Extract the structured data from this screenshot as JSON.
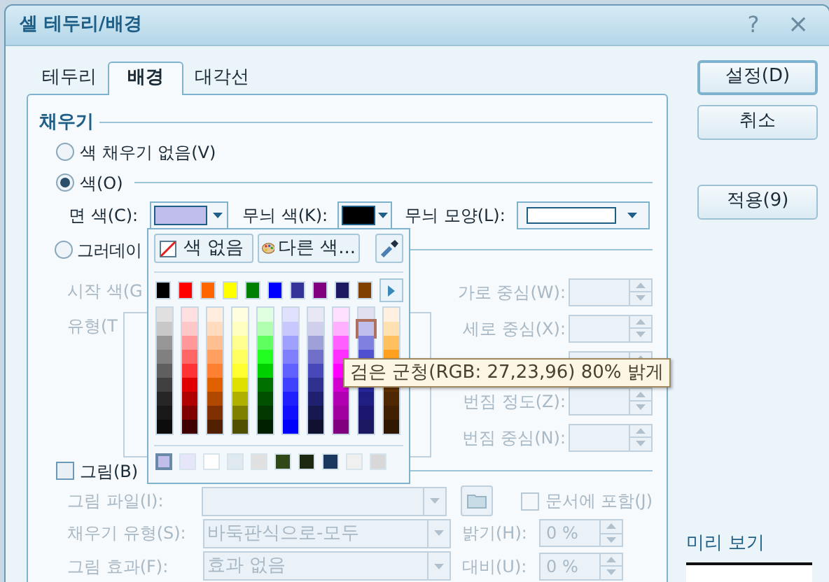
{
  "window": {
    "title": "셀 테두리/배경",
    "help": "?",
    "close": "×"
  },
  "tabs": [
    {
      "label": "테두리",
      "selected": false
    },
    {
      "label": "배경",
      "selected": true
    },
    {
      "label": "대각선",
      "selected": false
    }
  ],
  "fill": {
    "heading": "채우기",
    "options": [
      {
        "label": "색 채우기 없음(V)",
        "selected": false
      },
      {
        "label": "색(O)",
        "selected": true
      },
      {
        "label": "그러데이",
        "selected": false
      }
    ],
    "face_color": {
      "label": "면 색(C):",
      "color": "#c0bfeb"
    },
    "pattern_color": {
      "label": "무늬 색(K):",
      "color": "#000000"
    },
    "pattern_shape": {
      "label": "무늬 모양(L):"
    },
    "gradient_left": [
      "시작 색(G",
      "유형(T"
    ],
    "gradient_right": [
      "가로 중심(W):",
      "세로 중심(X):",
      "번짐 정도(Z):",
      "번짐 중심(N):"
    ]
  },
  "picture": {
    "label": "그림(B)",
    "checked": false,
    "file_label": "그림 파일(I):",
    "embed": {
      "label": "문서에 포함(J)",
      "checked": false
    },
    "fill_type": {
      "label": "채우기 유형(S):",
      "value": "바둑판식으로-모두"
    },
    "brightness": {
      "label": "밝기(H):",
      "value": "0 %"
    },
    "effect": {
      "label": "그림 효과(F):",
      "value": "효과 없음"
    },
    "contrast": {
      "label": "대비(U):",
      "value": "0 %"
    }
  },
  "buttons": [
    {
      "label": "설정(D)"
    },
    {
      "label": "취소"
    },
    {
      "label": "적용(9)"
    }
  ],
  "preview": {
    "label": "미리 보기"
  },
  "color_popup": {
    "no_color": "색 없음",
    "more_colors": "다른 색...",
    "standard": [
      {
        "color": "#000000"
      },
      {
        "color": "#ff0000"
      },
      {
        "color": "#ff6600"
      },
      {
        "color": "#ffff00"
      },
      {
        "color": "#008000"
      },
      {
        "color": "#0000ff"
      },
      {
        "color": "#333399"
      },
      {
        "color": "#800080"
      },
      {
        "color": "#1b1760"
      },
      {
        "color": "#804000"
      }
    ],
    "shades": [
      {
        "cells": [
          {
            "color": "#e0e0e0",
            "selected": false
          },
          {
            "color": "#c8c8c8",
            "selected": false
          },
          {
            "color": "#969696",
            "selected": false
          },
          {
            "color": "#808080",
            "selected": false
          },
          {
            "color": "#5f5f5f",
            "selected": false
          },
          {
            "color": "#404040",
            "selected": false
          },
          {
            "color": "#262626",
            "selected": false
          },
          {
            "color": "#181818",
            "selected": false
          },
          {
            "color": "#0c0c0c",
            "selected": false
          }
        ]
      },
      {
        "cells": [
          {
            "color": "#ffe0e0",
            "selected": false
          },
          {
            "color": "#ffc8c8",
            "selected": false
          },
          {
            "color": "#ff9999",
            "selected": false
          },
          {
            "color": "#ff6666",
            "selected": false
          },
          {
            "color": "#ff3333",
            "selected": false
          },
          {
            "color": "#e00000",
            "selected": false
          },
          {
            "color": "#b00000",
            "selected": false
          },
          {
            "color": "#800000",
            "selected": false
          },
          {
            "color": "#400000",
            "selected": false
          }
        ]
      },
      {
        "cells": [
          {
            "color": "#ffeee0",
            "selected": false
          },
          {
            "color": "#ffdcc0",
            "selected": false
          },
          {
            "color": "#ffbf90",
            "selected": false
          },
          {
            "color": "#ffa060",
            "selected": false
          },
          {
            "color": "#ff8030",
            "selected": false
          },
          {
            "color": "#e06000",
            "selected": false
          },
          {
            "color": "#b04800",
            "selected": false
          },
          {
            "color": "#803000",
            "selected": false
          },
          {
            "color": "#502000",
            "selected": false
          }
        ]
      },
      {
        "cells": [
          {
            "color": "#ffffe0",
            "selected": false
          },
          {
            "color": "#ffffc0",
            "selected": false
          },
          {
            "color": "#ffff90",
            "selected": false
          },
          {
            "color": "#ffff60",
            "selected": false
          },
          {
            "color": "#ffff30",
            "selected": false
          },
          {
            "color": "#e0e000",
            "selected": false
          },
          {
            "color": "#b0b000",
            "selected": false
          },
          {
            "color": "#808000",
            "selected": false
          },
          {
            "color": "#505000",
            "selected": false
          }
        ]
      },
      {
        "cells": [
          {
            "color": "#e0ffe0",
            "selected": false
          },
          {
            "color": "#b0ffb0",
            "selected": false
          },
          {
            "color": "#60ff60",
            "selected": false
          },
          {
            "color": "#20ff20",
            "selected": false
          },
          {
            "color": "#00d000",
            "selected": false
          },
          {
            "color": "#007000",
            "selected": false
          },
          {
            "color": "#005000",
            "selected": false
          },
          {
            "color": "#003800",
            "selected": false
          },
          {
            "color": "#002000",
            "selected": false
          }
        ]
      },
      {
        "cells": [
          {
            "color": "#e0e0ff",
            "selected": false
          },
          {
            "color": "#c8c8ff",
            "selected": false
          },
          {
            "color": "#a0a0ff",
            "selected": false
          },
          {
            "color": "#8080ff",
            "selected": false
          },
          {
            "color": "#6060ff",
            "selected": false
          },
          {
            "color": "#4040ff",
            "selected": false
          },
          {
            "color": "#2020ff",
            "selected": false
          },
          {
            "color": "#1010ff",
            "selected": false
          },
          {
            "color": "#0000ff",
            "selected": false
          }
        ]
      },
      {
        "cells": [
          {
            "color": "#e8e8f4",
            "selected": false
          },
          {
            "color": "#d0d0ec",
            "selected": false
          },
          {
            "color": "#a0a0d8",
            "selected": false
          },
          {
            "color": "#7070c8",
            "selected": false
          },
          {
            "color": "#4848b8",
            "selected": false
          },
          {
            "color": "#303090",
            "selected": false
          },
          {
            "color": "#202070",
            "selected": false
          },
          {
            "color": "#181850",
            "selected": false
          },
          {
            "color": "#101030",
            "selected": false
          }
        ]
      },
      {
        "cells": [
          {
            "color": "#ffe0ff",
            "selected": false
          },
          {
            "color": "#ffb0ff",
            "selected": false
          },
          {
            "color": "#ff60ff",
            "selected": false
          },
          {
            "color": "#ff30ff",
            "selected": false
          },
          {
            "color": "#ff00ff",
            "selected": false
          },
          {
            "color": "#d000d0",
            "selected": false
          },
          {
            "color": "#b000b0",
            "selected": false
          },
          {
            "color": "#a000a0",
            "selected": false
          },
          {
            "color": "#800080",
            "selected": false
          }
        ]
      },
      {
        "cells": [
          {
            "color": "#e0e0f0",
            "selected": false
          },
          {
            "color": "#c0bfeb",
            "selected": true
          },
          {
            "color": "#8080e0",
            "selected": false
          },
          {
            "color": "#5050d0",
            "selected": false
          },
          null,
          {
            "color": "#2828a0",
            "selected": false
          },
          {
            "color": "#201e80",
            "selected": false
          },
          {
            "color": "#1b1770",
            "selected": false
          },
          {
            "color": "#1b1760",
            "selected": false
          }
        ]
      },
      {
        "cells": [
          {
            "color": "#fff0e0",
            "selected": false
          },
          {
            "color": "#ffe0b0",
            "selected": false
          },
          {
            "color": "#ffc060",
            "selected": false
          },
          {
            "color": "#ffa020",
            "selected": false
          },
          null,
          {
            "color": "#603000",
            "selected": false
          },
          {
            "color": "#502800",
            "selected": false
          },
          {
            "color": "#402000",
            "selected": false
          },
          {
            "color": "#301800",
            "selected": false
          }
        ]
      }
    ],
    "recent": [
      {
        "color": "#c0bfeb",
        "selected": true
      },
      {
        "color": "#e6e6fa",
        "selected": false
      },
      {
        "color": "#ffffff",
        "selected": false
      },
      {
        "color": "#e0e8f0",
        "selected": false
      },
      {
        "color": "#e0e0e0",
        "selected": false
      },
      {
        "color": "#304818",
        "selected": false
      },
      {
        "color": "#1c2810",
        "selected": false
      },
      {
        "color": "#183860",
        "selected": false
      },
      {
        "color": "#f0f0f0",
        "selected": false
      },
      {
        "color": "#d8d8d8",
        "selected": false
      }
    ]
  },
  "tooltip": "검은 군청(RGB: 27,23,96) 80% 밝게"
}
